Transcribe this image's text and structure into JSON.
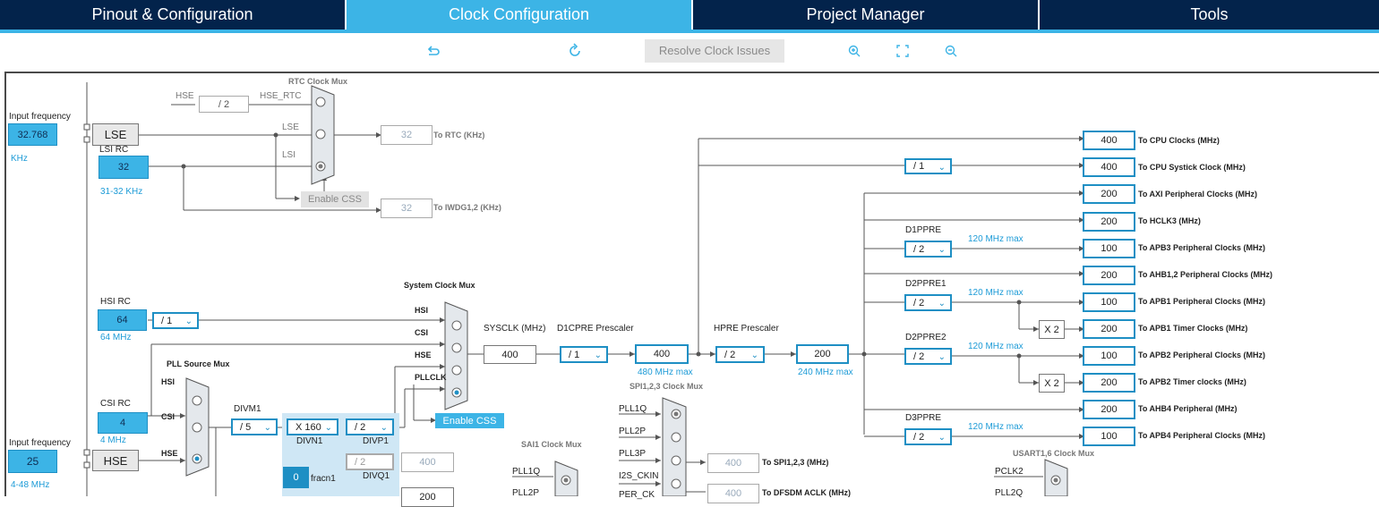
{
  "tabs": [
    {
      "label": "Pinout & Configuration",
      "active": false
    },
    {
      "label": "Clock Configuration",
      "active": true
    },
    {
      "label": "Project Manager",
      "active": false
    },
    {
      "label": "Tools",
      "active": false
    }
  ],
  "toolbar": {
    "undo_icon": "undo-icon",
    "reset_icon": "refresh-icon",
    "resolve_label": "Resolve Clock Issues",
    "zoom_in_icon": "zoom-in-icon",
    "fit_icon": "fit-screen-icon",
    "zoom_out_icon": "zoom-out-icon"
  },
  "colors": {
    "navy": "#03234b",
    "accent": "#3cb4e6"
  },
  "diagram": {
    "input_freq_label": "Input frequency",
    "lse_freq": "32.768",
    "khz": "KHz",
    "lse": "LSE",
    "lsi_rc": "LSI RC",
    "lsi_val": "32",
    "lsi_range": "31-32 KHz",
    "hse_top": "HSE",
    "hse_div": "/ 2",
    "hse_rtc": "HSE_RTC",
    "rtc_mux_title": "RTC Clock Mux",
    "mux_lse": "LSE",
    "mux_lsi": "LSI",
    "rtc_out": "32",
    "to_rtc": "To RTC (KHz)",
    "enable_css_top": "Enable CSS",
    "iwdg_out": "32",
    "to_iwdg": "To IWDG1,2 (KHz)",
    "hsi_rc": "HSI RC",
    "hsi_val": "64",
    "hsi_div": "/ 1",
    "hsi_mhz": "64 MHz",
    "sys_mux_title": "System Clock Mux",
    "sm_hsi": "HSI",
    "sm_csi": "CSI",
    "sm_hse": "HSE",
    "sm_pllclk": "PLLCLK",
    "enable_css": "Enable CSS",
    "sysclk_label": "SYSCLK (MHz)",
    "sysclk_val": "400",
    "d1cpre_label": "D1CPRE Prescaler",
    "d1cpre_val": "/ 1",
    "d1_out": "400",
    "d1_max": "480 MHz max",
    "hpre_label": "HPRE Prescaler",
    "hpre_val": "/ 2",
    "hpre_out": "200",
    "hpre_max": "240 MHz max",
    "pll_src_title": "PLL Source Mux",
    "pm_hsi": "HSI",
    "pm_csi": "CSI",
    "pm_hse": "HSE",
    "csi_rc": "CSI RC",
    "csi_val": "4",
    "csi_mhz": "4 MHz",
    "input_freq_label2": "Input frequency",
    "hse_val": "25",
    "hse": "HSE",
    "hse_range": "4-48 MHz",
    "divm1": "DIVM1",
    "divm1_val": "/ 5",
    "divn1_val": "X 160",
    "divn1": "DIVN1",
    "divp1_val": "/ 2",
    "divp1": "DIVP1",
    "fracn_val": "0",
    "fracn1": "fracn1",
    "divq_val": "/ 2",
    "divq_out": "400",
    "divq1": "DIVQ1",
    "divr_out": "200",
    "spi_mux_title": "SPI1,2,3 Clock Mux",
    "spi_pll1q": "PLL1Q",
    "spi_pll2p": "PLL2P",
    "spi_pll3p": "PLL3P",
    "spi_i2s": "I2S_CKIN",
    "spi_per": "PER_CK",
    "spi_out": "400",
    "to_spi": "To SPI1,2,3 (MHz)",
    "dfsdm_out": "400",
    "to_dfsdm": "To DFSDM ACLK (MHz)",
    "sai1_mux_title": "SAI1 Clock Mux",
    "sai_pll1q": "PLL1Q",
    "sai_pll2p": "PLL2P",
    "usart_mux_title": "USART1,6 Clock Mux",
    "us_pclk2": "PCLK2",
    "us_pll2q": "PLL2Q",
    "outputs": [
      {
        "value": "400",
        "label": "To CPU Clocks (MHz)"
      },
      {
        "value": "400",
        "label": "To CPU Systick Clock (MHz)"
      },
      {
        "value": "200",
        "label": "To AXI Peripheral Clocks (MHz)"
      },
      {
        "value": "200",
        "label": "To HCLK3 (MHz)"
      },
      {
        "value": "100",
        "label": "To APB3 Peripheral Clocks (MHz)"
      },
      {
        "value": "200",
        "label": "To AHB1,2 Peripheral Clocks (MHz)"
      },
      {
        "value": "100",
        "label": "To APB1 Peripheral Clocks (MHz)"
      },
      {
        "value": "200",
        "label": "To APB1 Timer Clocks (MHz)"
      },
      {
        "value": "100",
        "label": "To APB2 Peripheral Clocks (MHz)"
      },
      {
        "value": "200",
        "label": "To APB2 Timer clocks (MHz)"
      },
      {
        "value": "200",
        "label": "To AHB4 Peripheral (MHz)"
      },
      {
        "value": "100",
        "label": "To APB4 Peripheral Clocks (MHz)"
      }
    ],
    "systick_div": "/ 1",
    "d1ppre": "D1PPRE",
    "d1ppre_val": "/ 2",
    "d2ppre1": "D2PPRE1",
    "d2ppre1_val": "/ 2",
    "d2ppre2": "D2PPRE2",
    "d2ppre2_val": "/ 2",
    "d3ppre": "D3PPRE",
    "d3ppre_val": "/ 2",
    "max120": "120 MHz max",
    "x2": "X 2"
  }
}
